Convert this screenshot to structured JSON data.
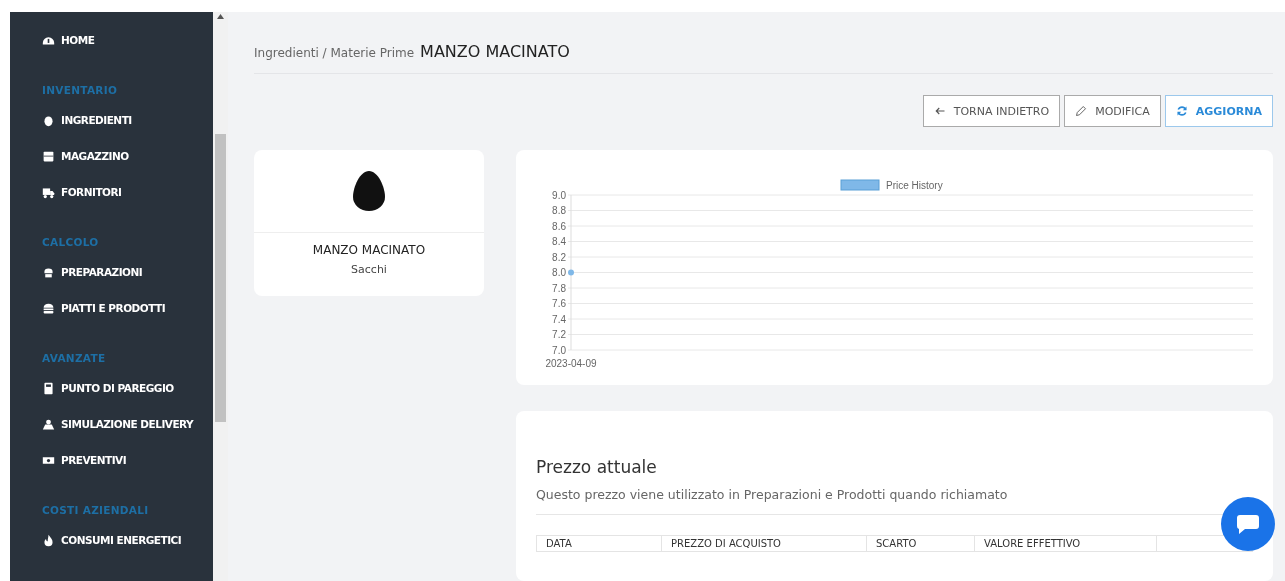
{
  "sidebar": {
    "home": {
      "label": "HOME"
    },
    "sections": [
      {
        "title": "INVENTARIO",
        "items": [
          {
            "label": "INGREDIENTI"
          },
          {
            "label": "MAGAZZINO"
          },
          {
            "label": "FORNITORI"
          }
        ]
      },
      {
        "title": "CALCOLO",
        "items": [
          {
            "label": "PREPARAZIONI"
          },
          {
            "label": "PIATTI E PRODOTTI"
          }
        ]
      },
      {
        "title": "AVANZATE",
        "items": [
          {
            "label": "PUNTO DI PAREGGIO"
          },
          {
            "label": "SIMULAZIONE DELIVERY"
          },
          {
            "label": "PREVENTIVI"
          }
        ]
      },
      {
        "title": "COSTI AZIENDALI",
        "items": [
          {
            "label": "CONSUMI ENERGETICI"
          }
        ]
      }
    ]
  },
  "breadcrumb": {
    "path": "Ingredienti / Materie Prime",
    "current": "MANZO MACINATO"
  },
  "actions": [
    {
      "label": "TORNA INDIETRO",
      "kind": "default"
    },
    {
      "label": "MODIFICA",
      "kind": "default"
    },
    {
      "label": "AGGIORNA",
      "kind": "primary"
    }
  ],
  "ingredient": {
    "name": "MANZO MACINATO",
    "unit": "Sacchi"
  },
  "chart": {
    "chart_data": {
      "type": "line",
      "categories": [
        "2023-04-09"
      ],
      "series": [
        {
          "name": "Price History",
          "color": "#7fb8e8",
          "values": [
            8.0
          ],
          "marker": true
        }
      ],
      "ylim": [
        7.0,
        9.0
      ],
      "grid": true,
      "yticks": [
        {
          "value": 7.0,
          "label": "7.0"
        },
        7.2,
        7.4,
        7.6,
        7.8,
        {
          "value": 8.0,
          "label": "8.0"
        },
        8.2,
        8.4,
        8.6,
        8.8,
        {
          "value": 9.0,
          "label": "9.0"
        }
      ]
    }
  },
  "price": {
    "title": "Prezzo attuale",
    "description": "Questo prezzo viene utilizzato in Preparazioni e Prodotti quando richiamato",
    "columns": [
      "DATA",
      "PREZZO DI ACQUISTO",
      "SCARTO",
      "VALORE EFFETTIVO"
    ]
  }
}
